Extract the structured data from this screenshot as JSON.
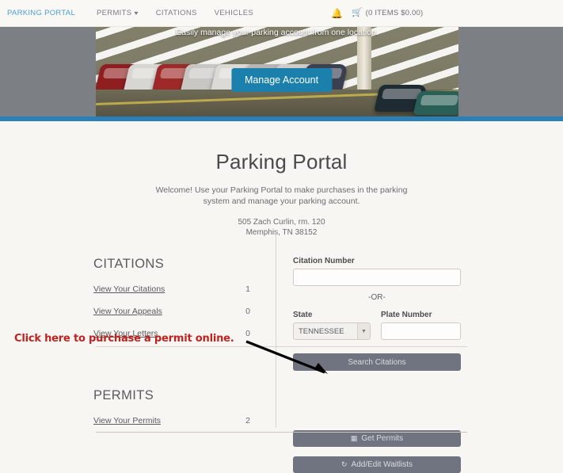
{
  "nav": {
    "brand": "PARKING PORTAL",
    "items": [
      {
        "label": "PERMITS",
        "caret": "▾"
      },
      {
        "label": "CITATIONS",
        "caret": ""
      },
      {
        "label": "VEHICLES",
        "caret": ""
      }
    ],
    "bell_icon": "notification-bell",
    "cart_icon": "shopping-cart",
    "cart_text": "(0 ITEMS $0.00)"
  },
  "hero": {
    "tagline": "Easily manage your parking account from one location.",
    "button_label": "Manage Account",
    "button_color": "#1b80ab",
    "rule_color": "#2a7fb8"
  },
  "page": {
    "title": "Parking Portal",
    "welcome": "Welcome! Use your Parking Portal to make purchases in the parking system and manage your parking account.",
    "address_line1": "505 Zach Curlin, rm. 120",
    "address_line2": "Memphis, TN 38152"
  },
  "citations": {
    "heading": "CITATIONS",
    "rows": [
      {
        "label": "View Your Citations",
        "count": "1"
      },
      {
        "label": "View Your Appeals",
        "count": "0"
      },
      {
        "label": "View Your Letters",
        "count": "0"
      }
    ]
  },
  "permits": {
    "heading": "PERMITS",
    "rows": [
      {
        "label": "View Your Permits",
        "count": "2"
      }
    ]
  },
  "citation_search": {
    "number_label": "Citation Number",
    "number_value": "",
    "number_placeholder": "",
    "or_text": "-OR-",
    "state_label": "State",
    "state_value": "TENNESSEE",
    "state_options": [
      "TENNESSEE"
    ],
    "plate_label": "Plate Number",
    "plate_value": "",
    "plate_placeholder": "",
    "search_button": "Search Citations"
  },
  "permit_actions": {
    "get_permits_label": "Get Permits",
    "get_permits_icon": "grid-columns-icon",
    "waitlist_label": "Add/Edit Waitlists",
    "waitlist_icon": "refresh-sync-icon"
  },
  "annotation": {
    "text": "Click here to purchase a permit online.",
    "color": "#c0231f",
    "arrow_color": "#000000"
  }
}
